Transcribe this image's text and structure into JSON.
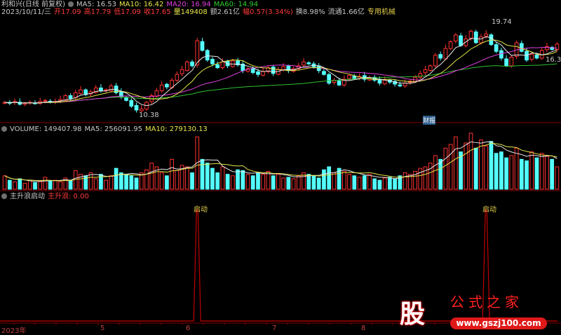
{
  "header": {
    "stock_name": "利和兴(日线 前复权)",
    "ma5": "MA5: 16.53",
    "ma10": "MA10: 16.42",
    "ma20": "MA20: 16.94",
    "ma60": "MA60: 14.94",
    "date": "2023/10/11/三",
    "open": "开17.09",
    "high": "高17.79",
    "low": "低17.09",
    "close": "收17.65",
    "volume": "量149408",
    "amount": "额2.61亿",
    "change": "幅0.57(3.34%)",
    "turnover": "换8.98%",
    "float": "流通1.66亿",
    "sector": "专用机械"
  },
  "price_labels": {
    "high_mark": "19.74",
    "low_mark": "10.38",
    "last_mark": "16.30",
    "event_badge": "财报"
  },
  "volume_panel": {
    "title": "VOLUME: 149407.98",
    "ma5": "MA5: 256091.95",
    "ma10": "MA10: 279130.13"
  },
  "indicator_panel": {
    "title": "主升浪启动",
    "value": "主升浪: 0.00",
    "signal_label_1": "启动",
    "signal_label_2": "启动"
  },
  "x_axis": {
    "labels": [
      "2023年",
      "5",
      "6",
      "7",
      "8"
    ]
  },
  "watermark": {
    "glyph": "股",
    "name": "公式之家",
    "url": "www.gszj100.com"
  },
  "colors": {
    "up": "#ff3232",
    "down": "#54ffff",
    "ma5": "#e8e8e8",
    "ma10": "#e6e64a",
    "ma20": "#e040e0",
    "ma60": "#30c030",
    "signal": "#c00000"
  },
  "chart_data": {
    "type": "candlestick",
    "closes": [
      11.6,
      11.5,
      11.7,
      11.4,
      11.5,
      11.6,
      11.5,
      11.7,
      11.8,
      11.6,
      11.7,
      11.9,
      12.3,
      12.0,
      12.6,
      12.9,
      12.4,
      12.7,
      13.1,
      12.8,
      12.9,
      13.3,
      12.6,
      12.2,
      11.8,
      11.2,
      10.8,
      10.9,
      11.6,
      12.3,
      12.8,
      13.4,
      13.2,
      13.9,
      14.5,
      15.0,
      15.8,
      15.4,
      18.0,
      17.0,
      16.0,
      15.6,
      15.2,
      15.8,
      15.4,
      15.9,
      15.5,
      14.9,
      15.1,
      14.7,
      14.5,
      14.8,
      15.2,
      14.6,
      15.0,
      15.3,
      14.9,
      15.1,
      15.4,
      15.8,
      15.6,
      15.3,
      14.9,
      14.5,
      13.6,
      13.9,
      13.4,
      14.0,
      14.4,
      14.1,
      14.3,
      14.0,
      14.2,
      13.9,
      13.6,
      13.9,
      13.7,
      13.5,
      13.3,
      13.6,
      13.8,
      14.2,
      14.6,
      15.0,
      15.4,
      16.5,
      16.2,
      17.2,
      17.9,
      18.6,
      17.5,
      18.2,
      19.0,
      17.8,
      18.4,
      18.7,
      17.6,
      16.9,
      16.2,
      15.4,
      16.3,
      17.8,
      16.9,
      16.0,
      16.6,
      16.2,
      17.0,
      17.4,
      17.1,
      17.65
    ],
    "volumes_10k": [
      18,
      12,
      10,
      14,
      8,
      12,
      9,
      10,
      16,
      11,
      12,
      10,
      15,
      12,
      25,
      20,
      18,
      22,
      14,
      20,
      12,
      18,
      28,
      22,
      20,
      18,
      15,
      22,
      26,
      35,
      30,
      22,
      18,
      40,
      25,
      32,
      30,
      22,
      70,
      40,
      35,
      28,
      22,
      30,
      20,
      18,
      26,
      25,
      20,
      18,
      22,
      20,
      24,
      18,
      20,
      15,
      16,
      14,
      18,
      22,
      20,
      18,
      15,
      26,
      30,
      22,
      28,
      24,
      20,
      18,
      16,
      18,
      20,
      14,
      12,
      15,
      16,
      14,
      18,
      22,
      20,
      24,
      28,
      30,
      35,
      45,
      40,
      55,
      60,
      70,
      50,
      62,
      75,
      55,
      66,
      58,
      64,
      48,
      50,
      42,
      45,
      55,
      40,
      38,
      50,
      42,
      48,
      44,
      40,
      30
    ],
    "price_range": [
      10.0,
      20.2
    ],
    "signal_bars": [
      38,
      95
    ]
  }
}
